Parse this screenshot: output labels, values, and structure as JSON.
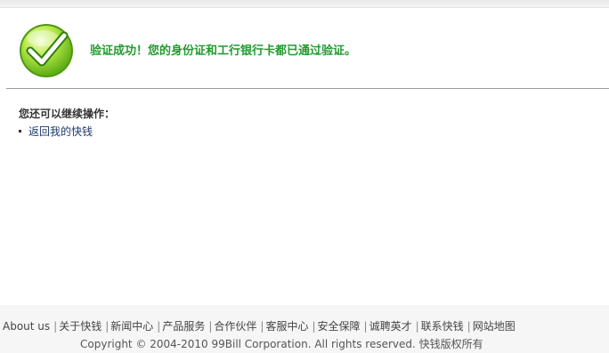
{
  "result": {
    "message": "验证成功！您的身份证和工行银行卡都已通过验证。",
    "icon": "check-icon",
    "accent_color": "#229a2f"
  },
  "next_steps": {
    "title": "您还可以继续操作：",
    "items": [
      {
        "label": "返回我的快钱"
      }
    ]
  },
  "footer": {
    "links": [
      {
        "label": "About us"
      },
      {
        "label": "关于快钱"
      },
      {
        "label": "新闻中心"
      },
      {
        "label": "产品服务"
      },
      {
        "label": "合作伙伴"
      },
      {
        "label": "客服中心"
      },
      {
        "label": "安全保障"
      },
      {
        "label": "诚聘英才"
      },
      {
        "label": "联系快钱"
      },
      {
        "label": "网站地图"
      }
    ],
    "separator": "|",
    "copyright": "Copyright © 2004-2010 99Bill Corporation. All rights reserved. 快钱版权所有"
  }
}
